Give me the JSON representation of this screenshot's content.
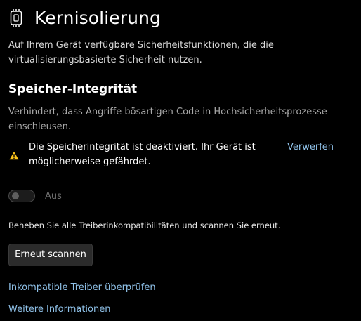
{
  "header": {
    "icon": "core-isolation-chip-icon",
    "title": "Kernisolierung"
  },
  "intro": {
    "text": "Auf Ihrem Gerät verfügbare Sicherheitsfunktionen, die die virtualisierungsbasierte Sicherheit nutzen."
  },
  "memory_integrity": {
    "title": "Speicher-Integrität",
    "description": "Verhindert, dass Angriffe bösartigen Code in Hochsicherheitsprozesse einschleusen.",
    "warning": {
      "icon": "warning-icon",
      "text": "Die Speicherintegrität ist deaktiviert. Ihr Gerät ist möglicherweise gefährdet.",
      "dismiss_label": "Verwerfen"
    },
    "toggle": {
      "state": "off",
      "label": "Aus"
    },
    "fix_hint": "Beheben Sie alle Treiberinkompatibilitäten und scannen Sie erneut.",
    "rescan_label": "Erneut scannen"
  },
  "links": {
    "check_drivers": "Inkompatible Treiber überprüfen",
    "more_info": "Weitere Informationen"
  },
  "colors": {
    "background": "#000000",
    "link": "#8fc1e8",
    "warning": "#fcc419",
    "secondary_text": "#a8a8a8"
  }
}
